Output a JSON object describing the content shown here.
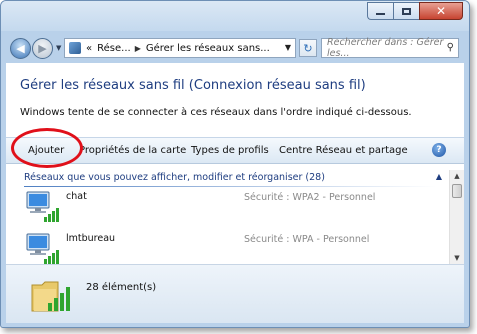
{
  "navigation": {
    "recent_arrow": "▼",
    "breadcrumb": [
      "«",
      "Rése...",
      "Gérer les réseaux sans..."
    ],
    "search_placeholder": "Rechercher dans : Gérer les..."
  },
  "content": {
    "title": "Gérer les réseaux sans fil (Connexion réseau sans fil)",
    "description": "Windows tente de se connecter à ces réseaux dans l'ordre indiqué ci-dessous."
  },
  "commandbar": {
    "add": "Ajouter",
    "adapter_properties": "Propriétés de la carte",
    "profile_types": "Types de profils",
    "network_center": "Centre Réseau et partage",
    "help": "?"
  },
  "networks": {
    "group_header": "Réseaux que vous pouvez afficher, modifier et réorganiser (28)",
    "items": [
      {
        "name": "chat",
        "security": "Sécurité : WPA2 - Personnel"
      },
      {
        "name": "lmtbureau",
        "security": "Sécurité : WPA - Personnel"
      }
    ]
  },
  "status": {
    "count_text": "28 élément(s)"
  },
  "colors": {
    "title_blue": "#1e3d80",
    "annotation_red": "#e0101a",
    "signal_green": "#2fa52f"
  },
  "icons": [
    "back-icon",
    "forward-icon",
    "refresh-icon",
    "search-icon",
    "help-icon",
    "wireless-network-icon",
    "network-folder-icon"
  ]
}
